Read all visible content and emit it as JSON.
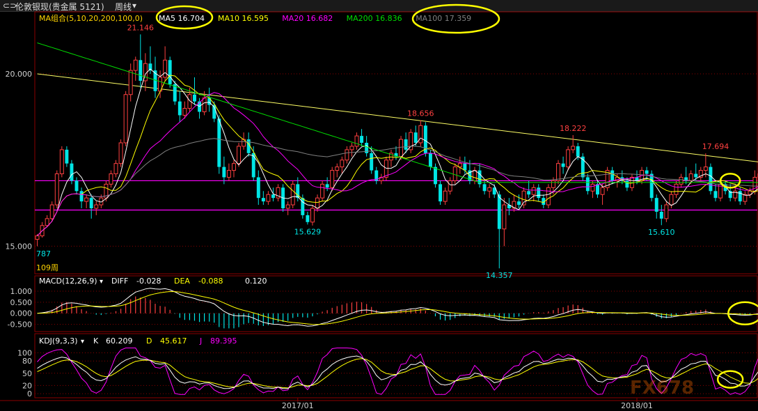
{
  "topbar": {
    "nav_icons": "⊂⊃",
    "instrument": "伦敦银现(贵金属 5121)",
    "period": "周线",
    "period_arrow": "▾"
  },
  "main_panel": {
    "ma_title": "MA组合(5,10,20,200,100,0)",
    "indicators": [
      {
        "label": "MA5",
        "value": "16.704",
        "color": "#ffffff"
      },
      {
        "label": "MA10",
        "value": "16.595",
        "color": "#ffff00"
      },
      {
        "label": "MA20",
        "value": "16.682",
        "color": "#ff00ff"
      },
      {
        "label": "MA200",
        "value": "16.836",
        "color": "#00dd00"
      },
      {
        "label": "MA100",
        "value": "17.359",
        "color": "#808080"
      }
    ],
    "y_ticks": [
      "20.000",
      "15.000"
    ],
    "y_tick_values": [
      20.0,
      15.0
    ],
    "ylim": [
      14.2,
      21.8
    ],
    "left_edge_label": "787",
    "bar_count_label": "109周",
    "annotations": [
      {
        "text": "21.146",
        "index": 21,
        "value": 21.146,
        "kind": "high",
        "color": "#ff4040"
      },
      {
        "text": "18.656",
        "index": 78,
        "value": 18.656,
        "kind": "high",
        "color": "#ff4040"
      },
      {
        "text": "18.222",
        "index": 109,
        "value": 18.222,
        "kind": "high",
        "color": "#ff4040"
      },
      {
        "text": "17.694",
        "index": 138,
        "value": 17.694,
        "kind": "high",
        "color": "#ff4040"
      },
      {
        "text": "15.629",
        "index": 55,
        "value": 15.629,
        "kind": "low",
        "color": "#00e5e5"
      },
      {
        "text": "14.357",
        "index": 94,
        "value": 14.357,
        "kind": "low",
        "color": "#00e5e5"
      },
      {
        "text": "15.610",
        "index": 127,
        "value": 15.61,
        "kind": "low",
        "color": "#00e5e5"
      }
    ],
    "horizontal_lines": [
      16.9,
      16.05
    ],
    "trendline": {
      "from": [
        0,
        20.0
      ],
      "to": [
        155,
        17.3
      ]
    }
  },
  "macd_panel": {
    "title": "MACD(12,26,9)",
    "diff_label": "DIFF",
    "diff_value": "-0.028",
    "dea_label": "DEA",
    "dea_value": "-0.088",
    "macd_value": "0.120",
    "y_ticks": [
      "1.000",
      "0.500",
      "0.000",
      "-0.500"
    ],
    "y_tick_values": [
      1.0,
      0.5,
      0.0,
      -0.5
    ],
    "ylim": [
      -0.7,
      1.25
    ]
  },
  "kdj_panel": {
    "title": "KDJ(9,3,3)",
    "k_label": "K",
    "k_value": "60.209",
    "d_label": "D",
    "d_value": "45.617",
    "j_label": "J",
    "j_value": "89.395",
    "y_ticks": [
      "100",
      "80",
      "50",
      "20",
      "0"
    ],
    "y_tick_values": [
      100,
      80,
      50,
      20,
      0
    ],
    "ylim": [
      -5,
      118
    ]
  },
  "x_axis": {
    "labels": [
      "2017/01",
      "2018/01"
    ],
    "label_indices": [
      53,
      122
    ]
  },
  "watermark": "FX678",
  "colors": {
    "up": "#ff4040",
    "down": "#00e5e5",
    "grid": "#8b0000",
    "highlight_circle": "#ffff00",
    "support_line": "#ff00ff"
  },
  "chart_data": {
    "type": "candlestick",
    "x_count": 147,
    "ohlc": [
      [
        15.2,
        15.35,
        15.0,
        15.3
      ],
      [
        15.3,
        15.7,
        15.25,
        15.6
      ],
      [
        15.6,
        15.9,
        15.55,
        15.8
      ],
      [
        15.8,
        16.3,
        15.75,
        16.2
      ],
      [
        16.2,
        17.2,
        16.1,
        17.1
      ],
      [
        17.1,
        17.9,
        17.0,
        17.8
      ],
      [
        17.8,
        17.9,
        17.3,
        17.4
      ],
      [
        17.4,
        17.5,
        16.8,
        16.9
      ],
      [
        16.9,
        17.0,
        16.5,
        16.6
      ],
      [
        16.6,
        16.7,
        16.1,
        16.3
      ],
      [
        16.3,
        16.5,
        16.1,
        16.4
      ],
      [
        16.4,
        16.5,
        15.8,
        16.1
      ],
      [
        16.1,
        16.3,
        15.9,
        16.2
      ],
      [
        16.2,
        16.5,
        16.1,
        16.4
      ],
      [
        16.4,
        16.9,
        16.3,
        16.8
      ],
      [
        16.8,
        17.2,
        16.7,
        17.1
      ],
      [
        17.1,
        17.5,
        17.0,
        17.4
      ],
      [
        17.4,
        18.1,
        17.3,
        18.0
      ],
      [
        18.0,
        19.5,
        17.9,
        19.4
      ],
      [
        19.4,
        20.3,
        19.2,
        20.1
      ],
      [
        20.1,
        20.5,
        19.8,
        20.4
      ],
      [
        20.4,
        21.146,
        19.6,
        19.8
      ],
      [
        19.8,
        20.6,
        19.5,
        20.3
      ],
      [
        20.3,
        20.8,
        20.0,
        20.1
      ],
      [
        20.1,
        20.5,
        19.3,
        19.5
      ],
      [
        19.5,
        20.1,
        19.3,
        19.9
      ],
      [
        19.9,
        20.8,
        19.8,
        20.4
      ],
      [
        20.4,
        20.5,
        19.6,
        19.7
      ],
      [
        19.7,
        19.8,
        19.1,
        19.2
      ],
      [
        19.2,
        19.5,
        18.6,
        18.8
      ],
      [
        18.8,
        19.2,
        18.7,
        19.0
      ],
      [
        19.0,
        19.6,
        18.9,
        19.4
      ],
      [
        19.4,
        19.9,
        19.1,
        19.2
      ],
      [
        19.2,
        19.3,
        18.7,
        18.9
      ],
      [
        18.9,
        19.5,
        18.8,
        19.3
      ],
      [
        19.3,
        19.6,
        18.9,
        19.1
      ],
      [
        19.1,
        19.2,
        18.6,
        18.7
      ],
      [
        18.7,
        18.8,
        17.1,
        17.3
      ],
      [
        17.3,
        17.6,
        16.8,
        17.0
      ],
      [
        17.0,
        17.4,
        16.9,
        17.2
      ],
      [
        17.2,
        17.5,
        17.0,
        17.4
      ],
      [
        17.4,
        18.0,
        17.3,
        17.9
      ],
      [
        17.9,
        18.3,
        17.8,
        18.1
      ],
      [
        18.1,
        18.3,
        17.6,
        17.7
      ],
      [
        17.7,
        17.9,
        16.9,
        17.0
      ],
      [
        17.0,
        17.2,
        16.2,
        16.4
      ],
      [
        16.4,
        16.6,
        16.2,
        16.3
      ],
      [
        16.3,
        16.6,
        16.2,
        16.5
      ],
      [
        16.5,
        16.7,
        16.3,
        16.4
      ],
      [
        16.4,
        16.8,
        16.3,
        16.7
      ],
      [
        16.7,
        16.8,
        16.0,
        16.1
      ],
      [
        16.1,
        16.3,
        15.9,
        16.2
      ],
      [
        16.2,
        16.9,
        16.1,
        16.8
      ],
      [
        16.8,
        17.0,
        16.3,
        16.4
      ],
      [
        16.4,
        16.5,
        15.8,
        15.9
      ],
      [
        15.9,
        16.0,
        15.629,
        15.7
      ],
      [
        15.7,
        16.2,
        15.6,
        16.1
      ],
      [
        16.1,
        16.5,
        16.0,
        16.4
      ],
      [
        16.4,
        16.9,
        16.3,
        16.8
      ],
      [
        16.8,
        17.0,
        16.6,
        16.7
      ],
      [
        16.7,
        17.3,
        16.6,
        17.2
      ],
      [
        17.2,
        17.4,
        17.0,
        17.3
      ],
      [
        17.3,
        17.6,
        17.1,
        17.5
      ],
      [
        17.5,
        17.9,
        17.4,
        17.8
      ],
      [
        17.8,
        18.0,
        17.6,
        17.9
      ],
      [
        17.9,
        18.3,
        17.8,
        18.2
      ],
      [
        18.2,
        18.4,
        17.9,
        18.0
      ],
      [
        18.0,
        18.2,
        17.6,
        17.7
      ],
      [
        17.7,
        17.9,
        17.1,
        17.2
      ],
      [
        17.2,
        17.3,
        16.8,
        16.9
      ],
      [
        16.9,
        17.1,
        16.8,
        17.0
      ],
      [
        17.0,
        17.6,
        16.9,
        17.5
      ],
      [
        17.5,
        17.8,
        17.3,
        17.7
      ],
      [
        17.7,
        17.9,
        17.5,
        17.6
      ],
      [
        17.6,
        18.2,
        17.5,
        18.1
      ],
      [
        18.1,
        18.3,
        17.7,
        17.8
      ],
      [
        17.8,
        18.4,
        17.7,
        18.3
      ],
      [
        18.3,
        18.5,
        17.9,
        18.0
      ],
      [
        18.0,
        18.656,
        17.9,
        18.5
      ],
      [
        18.5,
        18.6,
        17.6,
        17.7
      ],
      [
        17.7,
        17.8,
        17.2,
        17.3
      ],
      [
        17.3,
        17.4,
        16.7,
        16.8
      ],
      [
        16.8,
        16.9,
        16.2,
        16.3
      ],
      [
        16.3,
        16.7,
        16.2,
        16.6
      ],
      [
        16.6,
        17.0,
        16.5,
        16.9
      ],
      [
        16.9,
        17.4,
        16.8,
        17.3
      ],
      [
        17.3,
        17.6,
        17.1,
        17.4
      ],
      [
        17.4,
        17.6,
        17.1,
        17.2
      ],
      [
        17.2,
        17.5,
        16.8,
        16.9
      ],
      [
        16.9,
        17.3,
        16.8,
        17.2
      ],
      [
        17.2,
        17.4,
        16.7,
        16.8
      ],
      [
        16.8,
        16.9,
        16.5,
        16.6
      ],
      [
        16.6,
        16.8,
        16.4,
        16.7
      ],
      [
        16.7,
        16.8,
        16.4,
        16.5
      ],
      [
        16.5,
        16.6,
        14.357,
        15.5
      ],
      [
        15.5,
        16.4,
        15.0,
        16.2
      ],
      [
        16.2,
        16.4,
        15.9,
        16.1
      ],
      [
        16.1,
        16.5,
        16.0,
        16.3
      ],
      [
        16.3,
        16.5,
        16.1,
        16.2
      ],
      [
        16.2,
        16.7,
        16.1,
        16.6
      ],
      [
        16.6,
        16.9,
        16.4,
        16.5
      ],
      [
        16.5,
        16.8,
        16.3,
        16.7
      ],
      [
        16.7,
        16.8,
        16.3,
        16.4
      ],
      [
        16.4,
        16.5,
        16.1,
        16.2
      ],
      [
        16.2,
        16.8,
        16.1,
        16.7
      ],
      [
        16.7,
        17.0,
        16.5,
        16.9
      ],
      [
        16.9,
        17.5,
        16.8,
        17.4
      ],
      [
        17.4,
        17.6,
        17.1,
        17.3
      ],
      [
        17.3,
        17.9,
        17.2,
        17.8
      ],
      [
        17.8,
        18.222,
        17.7,
        17.9
      ],
      [
        17.9,
        18.0,
        17.5,
        17.6
      ],
      [
        17.6,
        17.7,
        16.9,
        17.0
      ],
      [
        17.0,
        17.1,
        16.5,
        16.6
      ],
      [
        16.6,
        16.9,
        16.4,
        16.8
      ],
      [
        16.8,
        16.9,
        16.4,
        16.5
      ],
      [
        16.5,
        16.8,
        16.2,
        16.7
      ],
      [
        16.7,
        17.3,
        16.6,
        17.2
      ],
      [
        17.2,
        17.3,
        16.8,
        16.9
      ],
      [
        16.9,
        17.1,
        16.7,
        17.0
      ],
      [
        17.0,
        17.2,
        16.8,
        16.9
      ],
      [
        16.9,
        17.0,
        16.6,
        16.7
      ],
      [
        16.7,
        17.1,
        16.6,
        17.0
      ],
      [
        17.0,
        17.2,
        16.8,
        16.9
      ],
      [
        16.9,
        17.3,
        16.8,
        17.2
      ],
      [
        17.2,
        17.3,
        16.9,
        17.1
      ],
      [
        17.1,
        17.2,
        16.3,
        16.4
      ],
      [
        16.4,
        16.5,
        15.8,
        16.0
      ],
      [
        16.0,
        16.2,
        15.61,
        15.8
      ],
      [
        15.8,
        16.3,
        15.7,
        16.2
      ],
      [
        16.2,
        16.6,
        16.1,
        16.5
      ],
      [
        16.5,
        16.9,
        16.4,
        16.8
      ],
      [
        16.8,
        17.1,
        16.7,
        17.0
      ],
      [
        17.0,
        17.3,
        16.8,
        16.9
      ],
      [
        16.9,
        17.2,
        16.8,
        17.1
      ],
      [
        17.1,
        17.4,
        16.9,
        17.0
      ],
      [
        17.0,
        17.3,
        16.9,
        17.2
      ],
      [
        17.2,
        17.694,
        17.0,
        17.3
      ],
      [
        17.3,
        17.4,
        16.5,
        16.6
      ],
      [
        16.6,
        16.8,
        16.3,
        16.4
      ],
      [
        16.4,
        16.9,
        16.3,
        16.8
      ],
      [
        16.8,
        16.9,
        16.5,
        16.6
      ],
      [
        16.6,
        16.8,
        16.3,
        16.4
      ],
      [
        16.4,
        16.7,
        16.3,
        16.6
      ],
      [
        16.6,
        16.7,
        16.2,
        16.3
      ],
      [
        16.3,
        16.6,
        16.2,
        16.5
      ],
      [
        16.5,
        16.7,
        16.4,
        16.6
      ],
      [
        16.6,
        17.2,
        16.5,
        17.0
      ],
      [
        17.0,
        17.2,
        16.9,
        17.1
      ]
    ]
  }
}
